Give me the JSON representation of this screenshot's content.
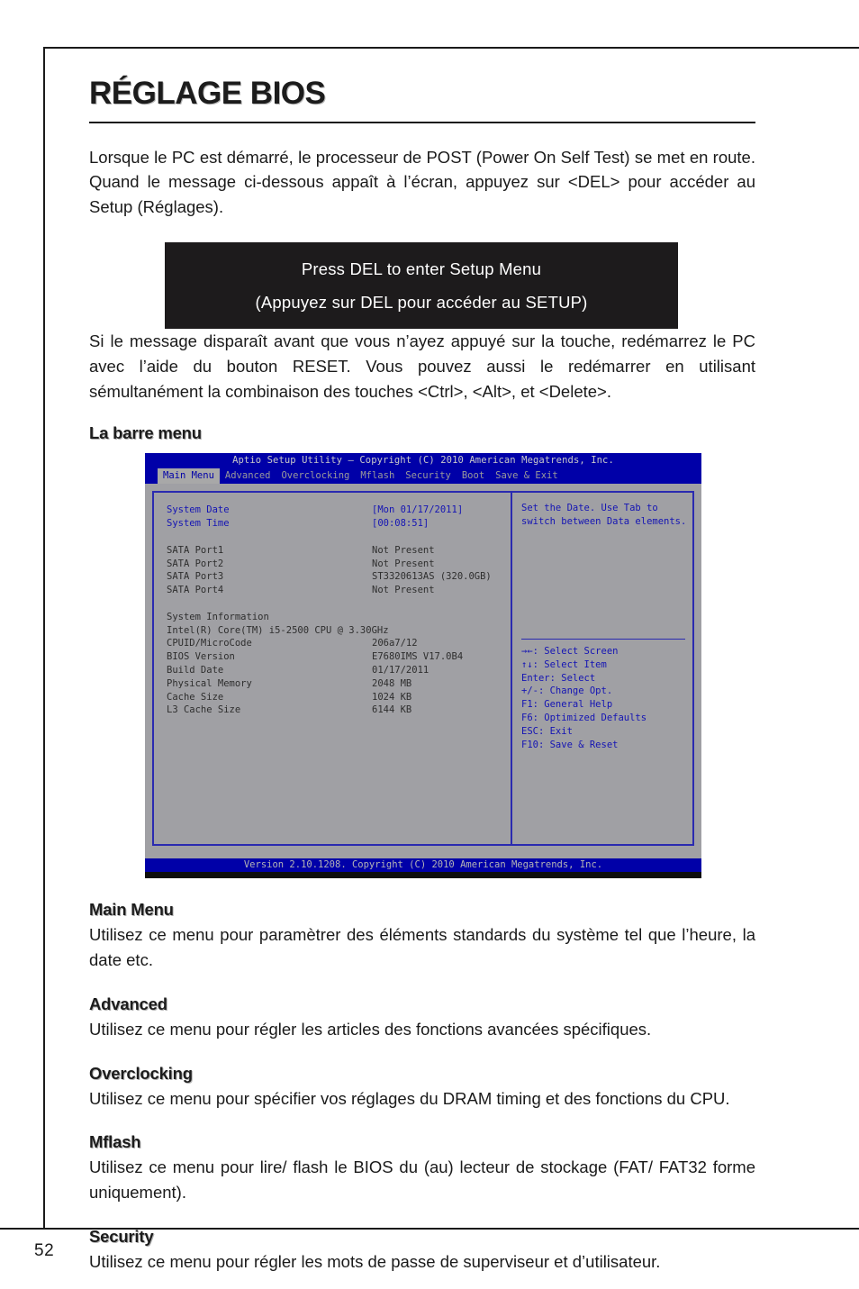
{
  "page": {
    "number": "52"
  },
  "document": {
    "title": "RÉGLAGE BIOS",
    "intro_paragraph": "Lorsque le PC est démarré, le processeur de POST (Power On Self Test) se met en route. Quand le message ci-dessous appaît à l’écran, appuyez sur <DEL> pour accéder au Setup (Réglages).",
    "post_message": {
      "line1": "Press DEL to enter Setup Menu",
      "line2": "(Appuyez sur DEL pour accéder au SETUP)"
    },
    "second_paragraph": "Si le message disparaît avant que vous n’ayez appuyé sur la touche, redémarrez le PC avec l’aide du bouton RESET. Vous pouvez aussi le redémarrer en utilisant sémultanément la combinaison des touches <Ctrl>, <Alt>, et <Delete>.",
    "menu_bar_heading": "La barre menu",
    "sections": [
      {
        "heading": "Main Menu",
        "text": "Utilisez ce menu pour paramètrer des éléments standards du système tel que l’heure, la date etc."
      },
      {
        "heading": "Advanced",
        "text": "Utilisez ce menu pour régler les articles des fonctions avancées spécifiques."
      },
      {
        "heading": "Overclocking",
        "text": "Utilisez ce menu pour spécifier vos réglages du DRAM timing et des fonctions du CPU."
      },
      {
        "heading": "Mflash",
        "text": "Utilisez ce menu pour  lire/ flash le BIOS du (au) lecteur de stockage (FAT/ FAT32 forme uniquement)."
      },
      {
        "heading": "Security",
        "text": "Utilisez ce menu pour régler les mots de passe de superviseur et d’utilisateur."
      }
    ]
  },
  "bios": {
    "title_bar": "Aptio Setup Utility – Copyright (C) 2010 American Megatrends, Inc.",
    "version_bar": "Version 2.10.1208. Copyright (C) 2010 American Megatrends, Inc.",
    "menu_items": [
      {
        "label": "Main Menu",
        "active": true
      },
      {
        "label": "Advanced",
        "active": false
      },
      {
        "label": "Overclocking",
        "active": false
      },
      {
        "label": "Mflash",
        "active": false
      },
      {
        "label": "Security",
        "active": false
      },
      {
        "label": "Boot",
        "active": false
      },
      {
        "label": "Save & Exit",
        "active": false
      }
    ],
    "settings": {
      "date_label": "System Date",
      "date_value": "[Mon 01/17/2011]",
      "time_label": "System Time",
      "time_value": "[00:08:51]",
      "sata": [
        {
          "label": "SATA Port1",
          "value": "Not Present"
        },
        {
          "label": "SATA Port2",
          "value": "Not Present"
        },
        {
          "label": "SATA Port3",
          "value": "ST3320613AS (320.0GB)"
        },
        {
          "label": "SATA Port4",
          "value": "Not Present"
        }
      ],
      "system_information_heading": "System Information",
      "cpu_name": "Intel(R) Core(TM) i5-2500 CPU @ 3.30GHz",
      "info_rows": [
        {
          "label": "CPUID/MicroCode",
          "value": "206a7/12"
        },
        {
          "label": "BIOS Version",
          "value": "E7680IMS V17.0B4"
        },
        {
          "label": "Build Date",
          "value": "01/17/2011"
        },
        {
          "label": "Physical Memory",
          "value": "2048 MB"
        },
        {
          "label": "Cache Size",
          "value": "1024 KB"
        },
        {
          "label": "L3 Cache Size",
          "value": "6144 KB"
        }
      ]
    },
    "help": {
      "description_line1": "Set the Date. Use Tab to",
      "description_line2": "switch between Data elements.",
      "keys": [
        "→←: Select Screen",
        "↑↓: Select Item",
        "Enter: Select",
        "+/-: Change Opt.",
        "F1: General Help",
        "F6: Optimized Defaults",
        "ESC: Exit",
        "F10: Save & Reset"
      ]
    }
  },
  "colors": {
    "bios_blue": "#0000a8",
    "bios_gray": "#a0a0a4",
    "bios_text_blue": "#1414b4",
    "post_box_bg": "#1d1b1c"
  }
}
